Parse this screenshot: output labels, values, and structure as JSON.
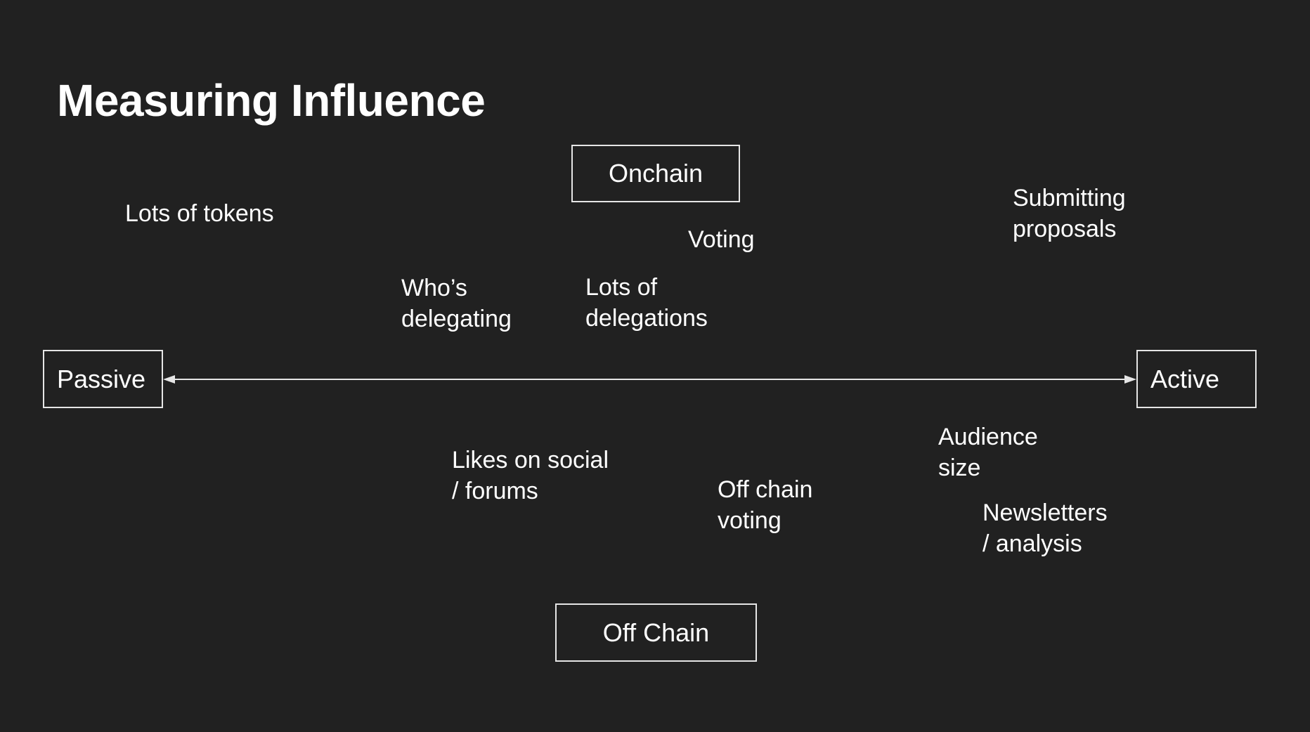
{
  "slide": {
    "title": "Measuring Influence",
    "background": "#212121",
    "foreground": "#ffffff"
  },
  "axis": {
    "vertical_top": "Onchain",
    "vertical_bottom": "Off Chain",
    "horizontal_left": "Passive",
    "horizontal_right": "Active"
  },
  "items": {
    "lots_of_tokens": "Lots of tokens",
    "voting": "Voting",
    "submitting_proposals": "Submitting\nproposals",
    "whos_delegating": "Who’s\ndelegating",
    "lots_of_delegations": "Lots of\ndelegations",
    "likes_on_social": "Likes on social\n/ forums",
    "off_chain_voting": "Off chain\nvoting",
    "audience_size": "Audience\nsize",
    "newsletters_analysis": "Newsletters\n/ analysis"
  }
}
